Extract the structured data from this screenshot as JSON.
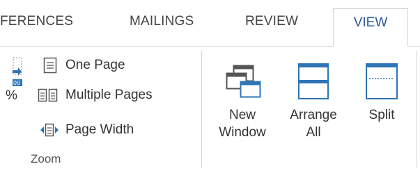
{
  "tabs": {
    "references": "FERENCES",
    "mailings": "MAILINGS",
    "review": "REVIEW",
    "view": "VIEW"
  },
  "zoom": {
    "percent_label": "%",
    "one_page": "One Page",
    "multiple_pages": "Multiple Pages",
    "page_width": "Page Width",
    "group_label": "Zoom"
  },
  "window": {
    "new_window_line1": "New",
    "new_window_line2": "Window",
    "arrange_all_line1": "Arrange",
    "arrange_all_line2": "All",
    "split": "Split"
  },
  "colors": {
    "accent": "#2b579a",
    "icon_blue": "#2e75b6",
    "icon_dark": "#555555"
  }
}
